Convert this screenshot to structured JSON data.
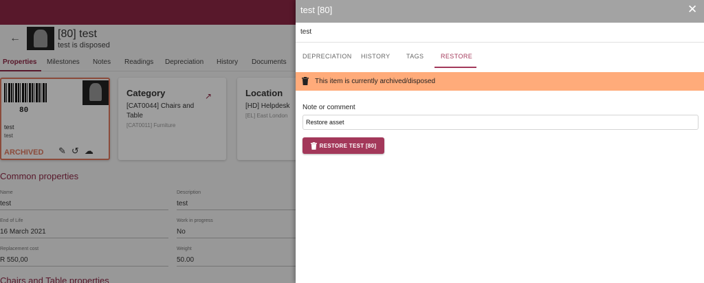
{
  "background": {
    "header": {
      "title": "[80] test",
      "subtitle": "test is disposed",
      "back_icon": "arrow-left-icon"
    },
    "tabs": [
      "Properties",
      "Milestones",
      "Notes",
      "Readings",
      "Depreciation",
      "History",
      "Documents"
    ],
    "asset_card": {
      "barcode_number": "80",
      "line1": "test",
      "line2": "test",
      "status": "ARCHIVED",
      "icons": [
        "pencil-icon",
        "history-icon",
        "cloud-download-icon"
      ]
    },
    "category_card": {
      "title": "Category",
      "value": "[CAT0044] Chairs and Table",
      "secondary": "[CAT0011] Furniture"
    },
    "location_card": {
      "title": "Location",
      "value": "[HD] Helpdesk",
      "secondary": "[EL] East London"
    },
    "common_properties": {
      "title": "Common properties",
      "fields": [
        {
          "label": "Name",
          "value": "test"
        },
        {
          "label": "Description",
          "value": "test"
        },
        {
          "label": "End of Life",
          "value": "16 March 2021"
        },
        {
          "label": "Work in progress",
          "value": "No"
        },
        {
          "label": "Replacement cost",
          "value": "R 550,00"
        },
        {
          "label": "Weight",
          "value": "50.00"
        }
      ]
    },
    "next_section_title": "Chairs and Table properties"
  },
  "panel": {
    "title": "test [80]",
    "subtitle": "test",
    "close_icon": "close-icon",
    "tabs": [
      {
        "label": "DEPRECIATION",
        "active": false
      },
      {
        "label": "HISTORY",
        "active": false
      },
      {
        "label": "TAGS",
        "active": false
      },
      {
        "label": "RESTORE",
        "active": true
      }
    ],
    "alert": {
      "icon": "trash-icon",
      "text": "This item is currently archived/disposed",
      "color": "#ffab7a"
    },
    "note": {
      "label": "Note or comment",
      "value": "Restore asset",
      "placeholder": ""
    },
    "restore_button": {
      "label": "RESTORE TEST [80]",
      "icon": "trash-icon",
      "color": "#a3385a"
    }
  },
  "colors": {
    "brand": "#8e2846",
    "accent": "#a3385a",
    "panel_header": "#a3a3a3",
    "archived": "#e07a5f"
  }
}
